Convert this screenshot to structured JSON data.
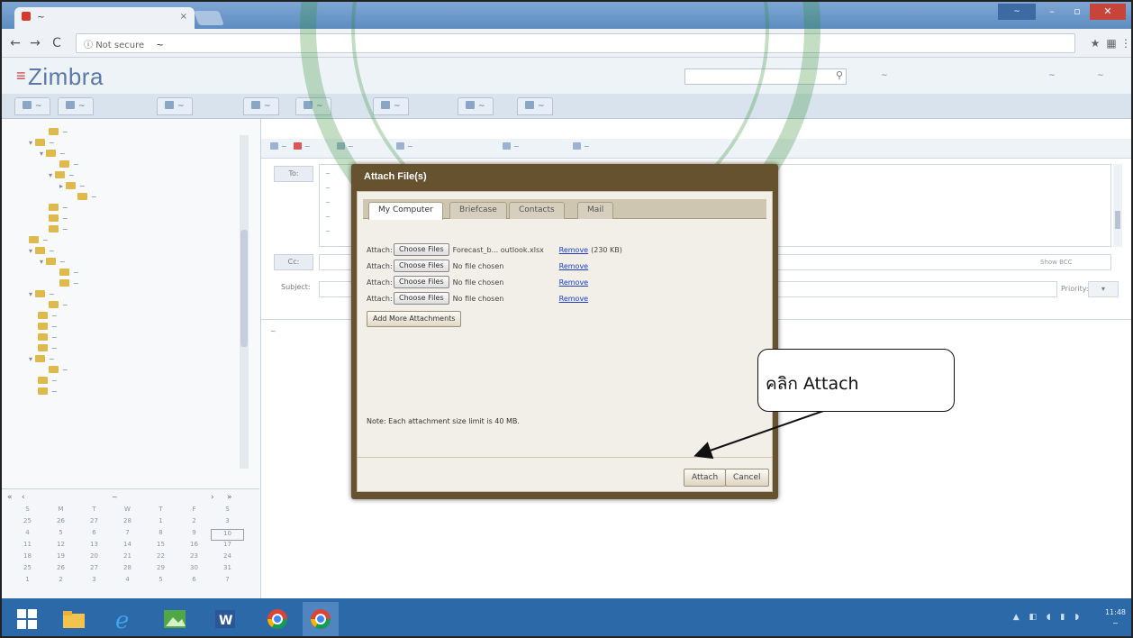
{
  "browser": {
    "tab_title": "~",
    "address_insecure": "Not secure",
    "address_url": "~",
    "window_user": "~"
  },
  "zimbra": {
    "logo": "Zimbra",
    "user_email": "~",
    "help": "~",
    "logout": "~",
    "app_tabs": [
      "~",
      "~",
      "~",
      "~",
      "~",
      "~",
      "~",
      "~"
    ]
  },
  "compose_toolbar": [
    "~",
    "~",
    "~",
    "~",
    "~",
    "~"
  ],
  "compose": {
    "to_label": "To:",
    "cc_label": "Cc:",
    "subject_label": "Subject:",
    "show_bcc": "Show BCC",
    "priority_label": "Priority:",
    "body_text": "~"
  },
  "folders": [
    "~",
    "~",
    "~",
    "~",
    "~",
    "~",
    "~",
    "~",
    "~",
    "~",
    "~",
    "~",
    "~",
    "~",
    "~",
    "~",
    "~",
    "~",
    "~",
    "~",
    "~",
    "~",
    "~",
    "~",
    "~"
  ],
  "minical": {
    "month": "~",
    "dow": [
      "S",
      "M",
      "T",
      "W",
      "T",
      "F",
      "S"
    ],
    "weeks": [
      [
        "25",
        "26",
        "27",
        "28",
        "1",
        "2",
        "3"
      ],
      [
        "4",
        "5",
        "6",
        "7",
        "8",
        "9",
        "10"
      ],
      [
        "11",
        "12",
        "13",
        "14",
        "15",
        "16",
        "17"
      ],
      [
        "18",
        "19",
        "20",
        "21",
        "22",
        "23",
        "24"
      ],
      [
        "25",
        "26",
        "27",
        "28",
        "29",
        "30",
        "31"
      ],
      [
        "1",
        "2",
        "3",
        "4",
        "5",
        "6",
        "7"
      ]
    ]
  },
  "dialog": {
    "title": "Attach File(s)",
    "tabs": [
      "My Computer",
      "Briefcase",
      "Contacts",
      "Mail"
    ],
    "rows": [
      {
        "label": "Attach:",
        "button": "Choose Files",
        "file": "Forecast_b... outlook.xlsx",
        "remove": "Remove",
        "size": "(230 KB)"
      },
      {
        "label": "Attach:",
        "button": "Choose Files",
        "file": "No file chosen",
        "remove": "Remove",
        "size": ""
      },
      {
        "label": "Attach:",
        "button": "Choose Files",
        "file": "No file chosen",
        "remove": "Remove",
        "size": ""
      },
      {
        "label": "Attach:",
        "button": "Choose Files",
        "file": "No file chosen",
        "remove": "Remove",
        "size": ""
      }
    ],
    "add_more": "Add More Attachments",
    "note": "Note: Each attachment size limit is 40 MB.",
    "attach_button": "Attach",
    "cancel_button": "Cancel"
  },
  "callout": "คลิก Attach",
  "taskbar": {
    "time": "11:48",
    "date": "~"
  },
  "colors": {
    "dialog_frame": "#67522f",
    "link": "#1b3ec7",
    "taskbar": "#2b69a8"
  }
}
